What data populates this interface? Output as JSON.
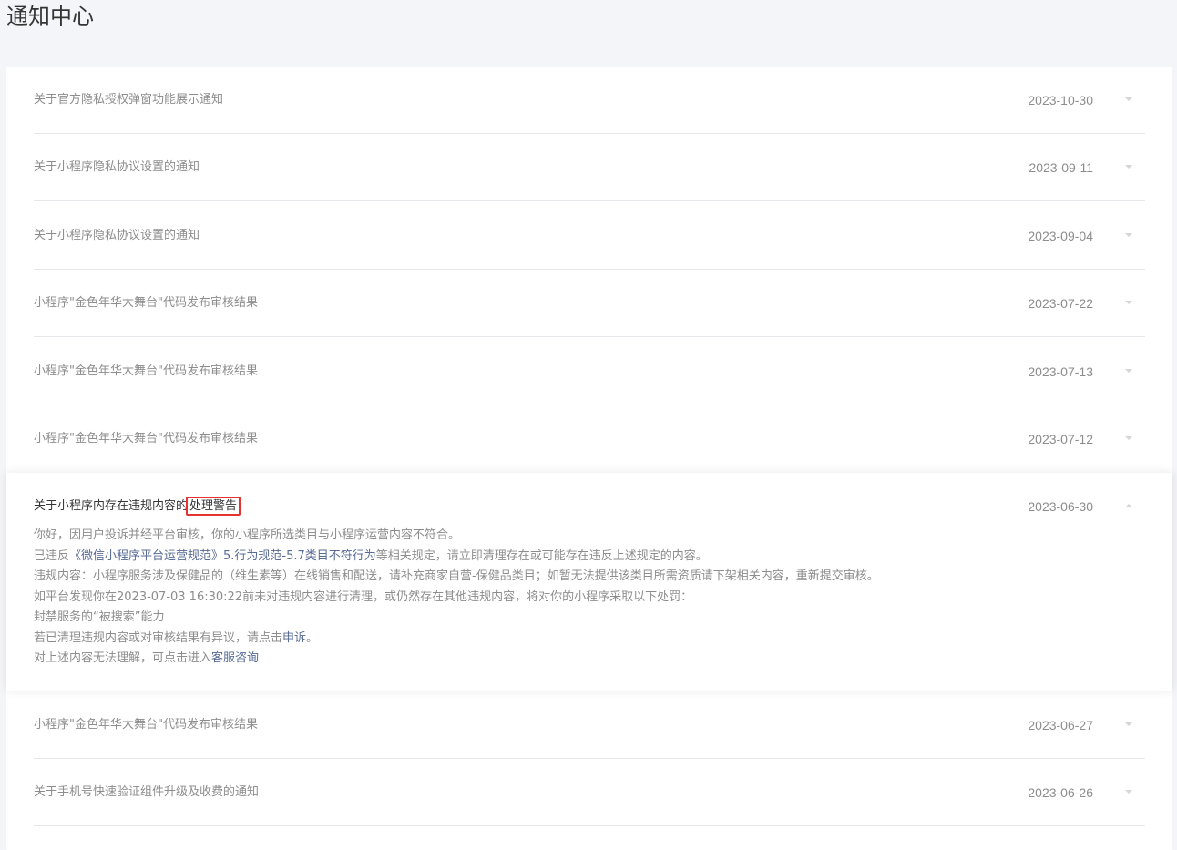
{
  "page": {
    "title": "通知中心"
  },
  "notices": [
    {
      "title": "关于官方隐私授权弹窗功能展示通知",
      "date": "2023-10-30"
    },
    {
      "title": "关于小程序隐私协议设置的通知",
      "date": "2023-09-11"
    },
    {
      "title": "关于小程序隐私协议设置的通知",
      "date": "2023-09-04"
    },
    {
      "title": "小程序\"金色年华大舞台\"代码发布审核结果",
      "date": "2023-07-22"
    },
    {
      "title": "小程序\"金色年华大舞台\"代码发布审核结果",
      "date": "2023-07-13"
    },
    {
      "title": "小程序\"金色年华大舞台\"代码发布审核结果",
      "date": "2023-07-12"
    }
  ],
  "expanded": {
    "title_prefix": "关于小程序内存在违规内容的",
    "title_highlight": "处理警告",
    "date": "2023-06-30",
    "line1": "你好，因用户投诉并经平台审核，你的小程序所选类目与小程序运营内容不符合。",
    "line2_prefix": "已违反",
    "line2_link": "《微信小程序平台运营规范》5.行为规范-5.7类目不符行为",
    "line2_suffix": "等相关规定，请立即清理存在或可能存在违反上述规定的内容。",
    "line3": "违规内容：小程序服务涉及保健品的（维生素等）在线销售和配送，请补充商家自营-保健品类目；如暂无法提供该类目所需资质请下架相关内容，重新提交审核。",
    "line4": "如平台发现你在2023-07-03 16:30:22前未对违规内容进行清理，或仍然存在其他违规内容，将对你的小程序采取以下处罚：",
    "line5": "封禁服务的“被搜索”能力",
    "line6_prefix": "若已清理违规内容或对审核结果有异议，请点击",
    "line6_link": "申诉",
    "line6_suffix": "。",
    "line7_prefix": "对上述内容无法理解，可点击进入",
    "line7_link": "客服咨询"
  },
  "notices_after": [
    {
      "title": "小程序\"金色年华大舞台\"代码发布审核结果",
      "date": "2023-06-27"
    },
    {
      "title": "关于手机号快速验证组件升级及收费的通知",
      "date": "2023-06-26"
    }
  ],
  "colors": {
    "background": "#f4f5f9",
    "card": "#ffffff",
    "link": "#576b95",
    "highlight_border": "#e5332f",
    "muted_text": "#8d8d8d"
  }
}
